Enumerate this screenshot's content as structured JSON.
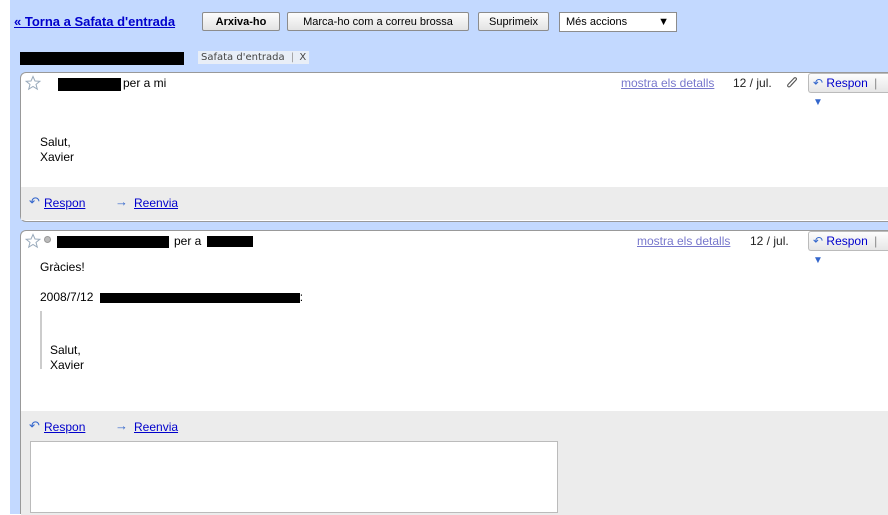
{
  "toolbar": {
    "back_label": "« Torna a Safata d'entrada",
    "archive_label": "Arxiva-ho",
    "spam_label": "Marca-ho com a correu brossa",
    "delete_label": "Suprimeix",
    "more_actions_label": "Més accions",
    "more_actions_arrow": "▼"
  },
  "thread": {
    "label_chip": "Safata d'entrada",
    "label_remove": "X"
  },
  "messages": [
    {
      "recipient_text": "per a mi",
      "details_link": "mostra els detalls",
      "date": "12 / jul.",
      "reply_label": "Respon",
      "reply_separator": "|",
      "body_line1": "Salut,",
      "body_line2": "Xavier",
      "footer_reply": "Respon",
      "footer_forward": "Reenvia"
    },
    {
      "recipient_text": "per a",
      "details_link": "mostra els detalls",
      "date": "12 / jul.",
      "reply_label": "Respon",
      "reply_separator": "|",
      "body_line1": "Gràcies!",
      "quote_header_prefix": "2008/7/12",
      "quote_header_suffix": ":",
      "quoted_line1": "Salut,",
      "quoted_line2": "Xavier",
      "footer_reply": "Respon",
      "footer_forward": "Reenvia"
    }
  ],
  "icons": {
    "star": "star-icon",
    "reply": "reply-arrow-icon",
    "forward": "forward-arrow-icon",
    "attachment": "paperclip-icon"
  },
  "colors": {
    "link": "#0000cc",
    "frame": "#c3d9ff",
    "details_link": "#7777cc"
  }
}
